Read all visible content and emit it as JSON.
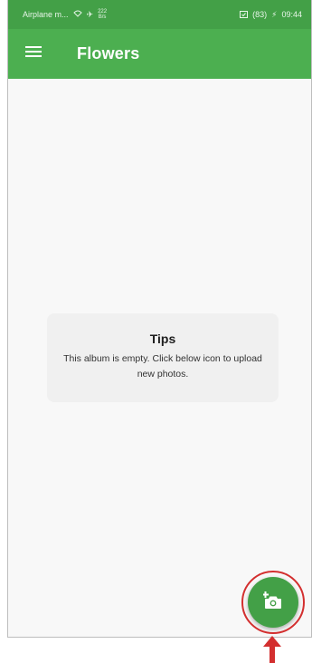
{
  "status_bar": {
    "carrier": "Airplane m...",
    "net_speed_value": "222",
    "net_speed_unit": "B/s",
    "battery": "(83)",
    "time": "09:44"
  },
  "app_bar": {
    "title": "Flowers",
    "color": "#4caf50"
  },
  "tips": {
    "title": "Tips",
    "message": "This album is empty. Click below icon to upload new photos."
  },
  "fab": {
    "icon": "add-photo-icon",
    "color": "#43a047"
  },
  "annotation": {
    "color": "#d32f2f"
  }
}
